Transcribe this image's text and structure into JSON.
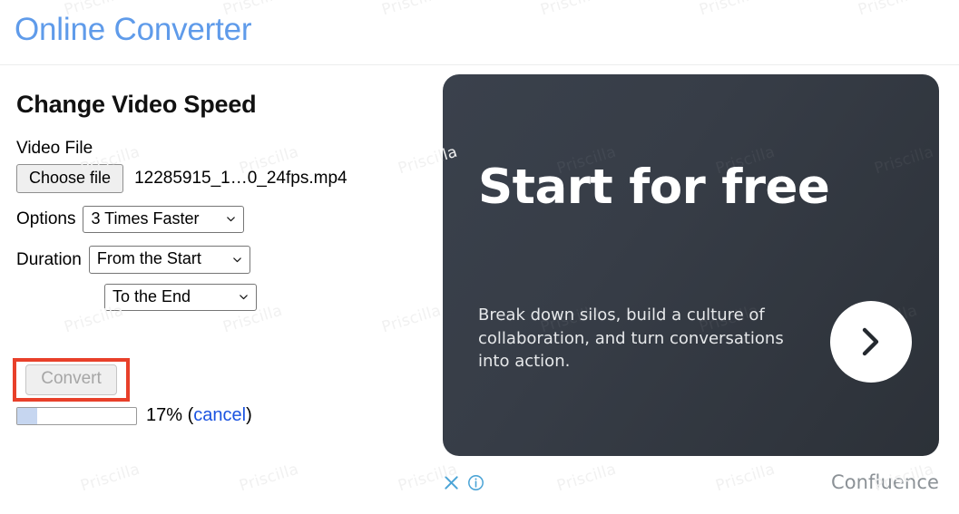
{
  "header": {
    "app_title": "Online Converter",
    "title_color": "#5f9bea"
  },
  "form": {
    "section_title": "Change Video Speed",
    "video_file_label": "Video File",
    "choose_file_label": "Choose file",
    "file_name": "12285915_1…0_24fps.mp4",
    "options_label": "Options",
    "options_value": "3 Times Faster",
    "duration_label": "Duration",
    "duration_from_value": "From the Start",
    "duration_to_value": "To the End",
    "convert_label": "Convert",
    "convert_disabled": true,
    "highlight_color": "#e8402a"
  },
  "progress": {
    "percent": 17,
    "percent_text": "17%",
    "open_paren": "(",
    "cancel_label": "cancel",
    "close_paren": ")",
    "fill_color": "#c6d6f0"
  },
  "ad": {
    "headline": "Start for free",
    "body": "Break down silos, build a culture of collaboration, and turn conversations into action.",
    "cta_icon": "chevron-right-icon",
    "close_icon": "close-icon",
    "info_icon": "info-icon",
    "brand": "Confluence",
    "card_color": "#373d47",
    "icon_color": "#4ba4d6"
  },
  "watermark": {
    "text": "Priscilla",
    "rows": 4,
    "cols": 7
  }
}
